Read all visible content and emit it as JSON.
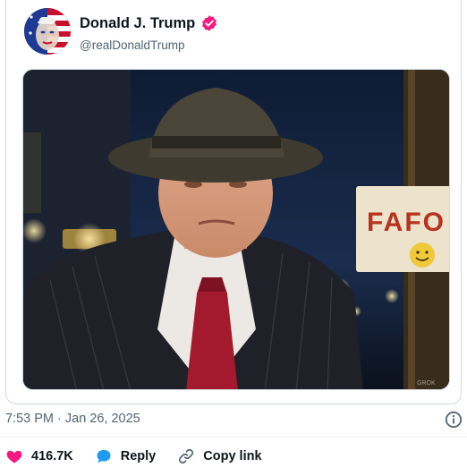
{
  "post": {
    "display_name": "Donald J. Trump",
    "handle": "@realDonaldTrump",
    "verified": true,
    "verified_color": "#f91880",
    "media": {
      "sign_text": "FAFO",
      "watermark": "GROK"
    }
  },
  "meta": {
    "timestamp": "7:53 PM · Jan 26, 2025"
  },
  "actions": {
    "likes": "416.7K",
    "reply_label": "Reply",
    "copy_link_label": "Copy link"
  },
  "colors": {
    "like": "#f91880",
    "reply": "#1d9bf0",
    "text": "#0f1419",
    "secondary": "#536471",
    "border": "#cfd9de"
  },
  "icons": {
    "like": "heart-icon",
    "reply": "speech-bubble-icon",
    "copy_link": "link-icon",
    "info": "info-icon",
    "verified": "verified-badge-icon"
  }
}
